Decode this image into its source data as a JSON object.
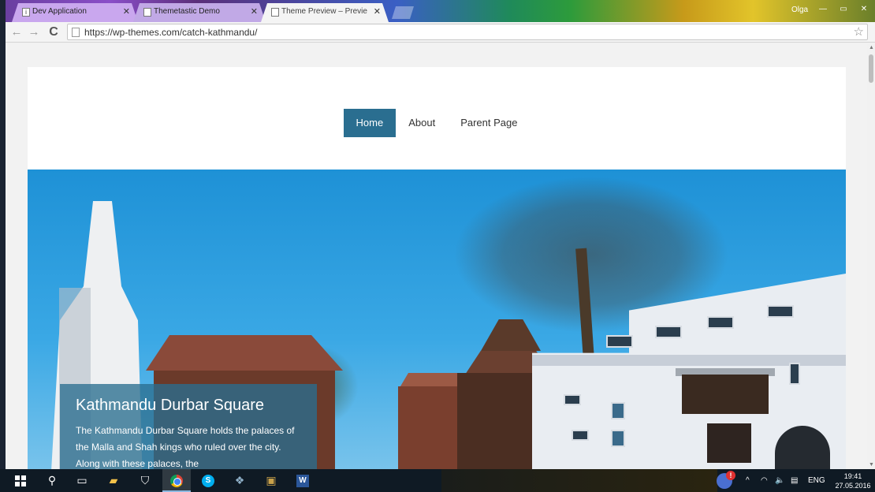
{
  "browser": {
    "tabs": [
      {
        "title": "Dev Application",
        "favicon": "i",
        "active": false
      },
      {
        "title": "Themetastic Demo",
        "favicon": "",
        "active": false
      },
      {
        "title": "Theme Preview – Previe",
        "favicon": "",
        "active": true
      }
    ],
    "tab_close": "✕",
    "user_name": "Olga",
    "window_controls": {
      "minimize": "—",
      "maximize": "▭",
      "close": "✕"
    },
    "toolbar": {
      "back": "←",
      "forward": "→",
      "reload": "C"
    },
    "url": "https://wp-themes.com/catch-kathmandu/",
    "star": "☆",
    "menu": "≡"
  },
  "site": {
    "nav": [
      {
        "label": "Home",
        "active": true
      },
      {
        "label": "About",
        "active": false
      },
      {
        "label": "Parent Page",
        "active": false
      }
    ],
    "slide": {
      "title": "Kathmandu Durbar Square",
      "text": "The Kathmandu Durbar Square holds the palaces of the Malla and Shah kings who ruled over the city. Along with these palaces, the"
    },
    "colors": {
      "accent": "#2a6e90",
      "sky": "#1e91d6"
    }
  },
  "taskbar": {
    "icons": [
      "windows-start-icon",
      "search-icon",
      "task-view-icon",
      "file-explorer-icon",
      "store-icon",
      "chrome-icon",
      "skype-icon",
      "app-icon",
      "app-icon",
      "word-icon"
    ],
    "skype_letter": "S",
    "word_letter": "W",
    "tray": {
      "alert_badge": "!",
      "chevron": "^",
      "wifi": "◠",
      "volume": "🔈",
      "message": "▤",
      "language": "ENG"
    },
    "time": "19:41",
    "date": "27.05.2016"
  }
}
